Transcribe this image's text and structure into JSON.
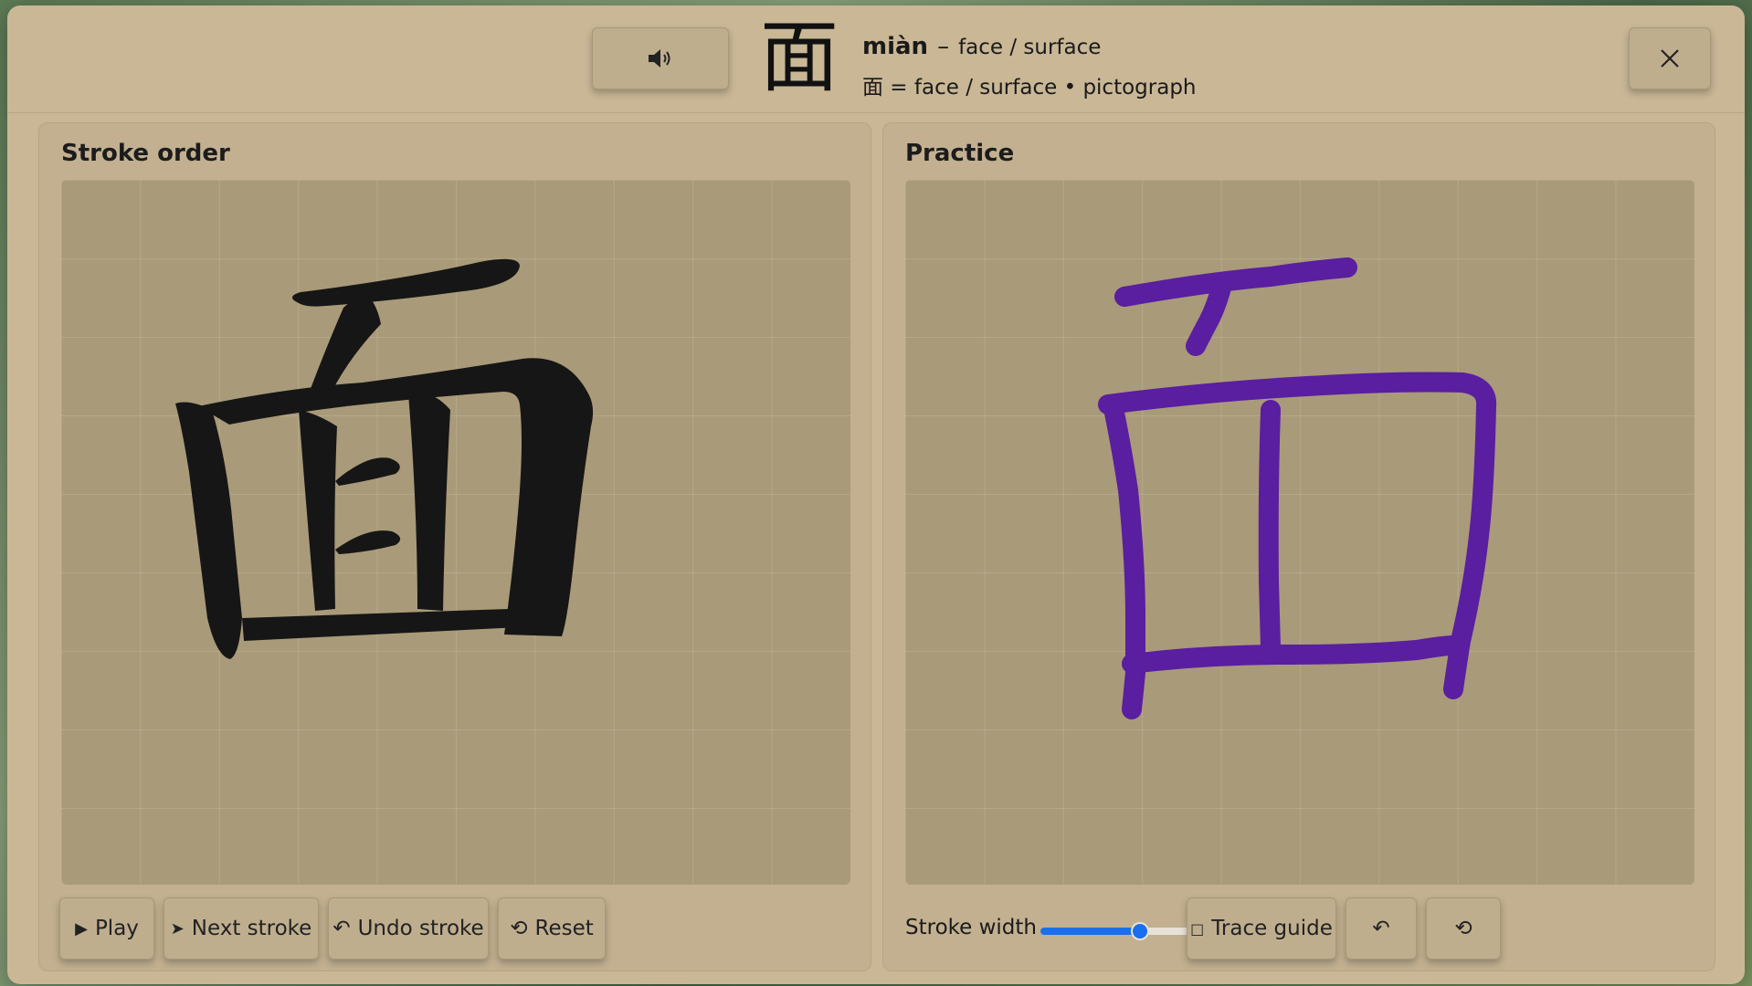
{
  "header": {
    "character": "面",
    "pinyin": "miàn",
    "dash": "–",
    "gloss": "face / surface",
    "breakdown": "面 = face / surface • pictograph",
    "sound_icon": "speaker-icon",
    "close_icon": "close-icon"
  },
  "stroke_order": {
    "title": "Stroke order",
    "buttons": [
      {
        "icon": "▶",
        "label": "Play"
      },
      {
        "icon": "➤",
        "label": "Next stroke"
      },
      {
        "icon": "↶",
        "label": "Undo stroke"
      },
      {
        "icon": "⟲",
        "label": "Reset"
      }
    ]
  },
  "practice": {
    "title": "Practice",
    "stroke_width_label": "Stroke width",
    "stroke_width_value": 0.48,
    "trace_guide_icon": "□",
    "trace_guide_label": "Trace guide",
    "undo_icon": "↶",
    "reset_icon": "⟲",
    "ink_color": "#5a1ea0"
  }
}
